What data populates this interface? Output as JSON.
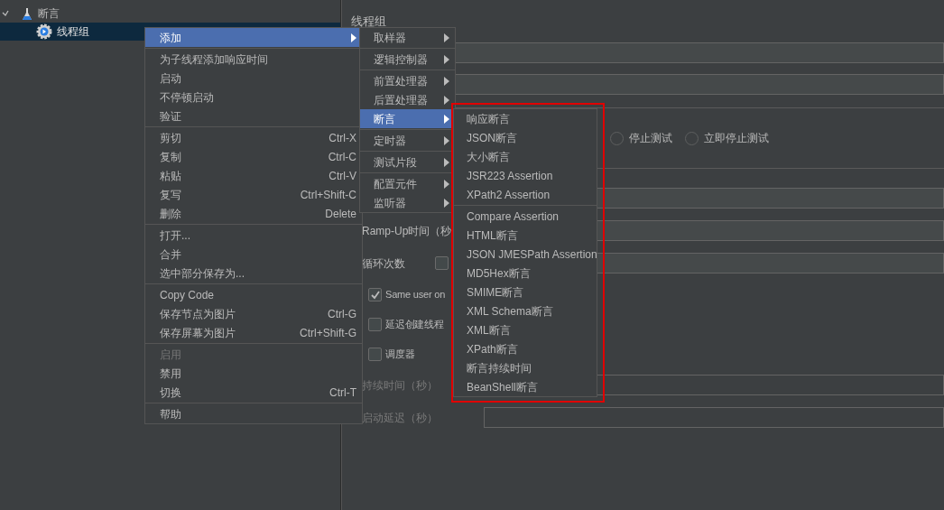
{
  "tree": [
    {
      "kind": "test_plan",
      "label": "断言",
      "expanded": true,
      "selected": false,
      "children": [
        {
          "kind": "thread_group",
          "label": "线程组",
          "selected": true
        }
      ]
    }
  ],
  "panel": {
    "title": "线程组",
    "error_actions": [
      {
        "label": "停止测试",
        "selected": false
      },
      {
        "label": "立即停止测试",
        "selected": false
      }
    ],
    "form": [
      {
        "kind": "field"
      },
      {
        "kind": "field",
        "label": "Ramp-Up时间（秒",
        "disabled": false
      },
      {
        "kind": "loop",
        "label": "循环次数",
        "checked": false
      },
      {
        "kind": "checkbox",
        "label": "Same user on",
        "checked": true
      },
      {
        "kind": "checkbox",
        "label": "延迟创建线程",
        "checked": false
      },
      {
        "kind": "checkbox",
        "label": "调度器",
        "checked": false
      },
      {
        "kind": "field",
        "label": "持续时间（秒）",
        "disabled": true
      },
      {
        "kind": "field",
        "label": "启动延迟（秒）",
        "disabled": true
      }
    ]
  },
  "context_menu": {
    "items": [
      {
        "kind": "item",
        "label": "添加",
        "submenu": true,
        "selected": true,
        "disabled": false
      },
      {
        "kind": "separator"
      },
      {
        "kind": "item",
        "label": "为子线程添加响应时间",
        "submenu": false,
        "selected": false,
        "disabled": false
      },
      {
        "kind": "item",
        "label": "启动",
        "submenu": false,
        "selected": false,
        "disabled": false
      },
      {
        "kind": "item",
        "label": "不停顿启动",
        "submenu": false,
        "selected": false,
        "disabled": false
      },
      {
        "kind": "item",
        "label": "验证",
        "submenu": false,
        "selected": false,
        "disabled": false
      },
      {
        "kind": "separator"
      },
      {
        "kind": "item",
        "label": "剪切",
        "shortcut": "Ctrl-X",
        "submenu": false,
        "selected": false,
        "disabled": false
      },
      {
        "kind": "item",
        "label": "复制",
        "shortcut": "Ctrl-C",
        "submenu": false,
        "selected": false,
        "disabled": false
      },
      {
        "kind": "item",
        "label": "粘贴",
        "shortcut": "Ctrl-V",
        "submenu": false,
        "selected": false,
        "disabled": false
      },
      {
        "kind": "item",
        "label": "复写",
        "shortcut": "Ctrl+Shift-C",
        "submenu": false,
        "selected": false,
        "disabled": false
      },
      {
        "kind": "item",
        "label": "删除",
        "shortcut": "Delete",
        "submenu": false,
        "selected": false,
        "disabled": false
      },
      {
        "kind": "separator"
      },
      {
        "kind": "item",
        "label": "打开...",
        "submenu": false,
        "selected": false,
        "disabled": false
      },
      {
        "kind": "item",
        "label": "合并",
        "submenu": false,
        "selected": false,
        "disabled": false
      },
      {
        "kind": "item",
        "label": "选中部分保存为...",
        "submenu": false,
        "selected": false,
        "disabled": false
      },
      {
        "kind": "separator"
      },
      {
        "kind": "item",
        "label": "Copy Code",
        "submenu": false,
        "selected": false,
        "disabled": false
      },
      {
        "kind": "item",
        "label": "保存节点为图片",
        "shortcut": "Ctrl-G",
        "submenu": false,
        "selected": false,
        "disabled": false
      },
      {
        "kind": "item",
        "label": "保存屏幕为图片",
        "shortcut": "Ctrl+Shift-G",
        "submenu": false,
        "selected": false,
        "disabled": false
      },
      {
        "kind": "separator"
      },
      {
        "kind": "item",
        "label": "启用",
        "submenu": false,
        "selected": false,
        "disabled": true
      },
      {
        "kind": "item",
        "label": "禁用",
        "submenu": false,
        "selected": false,
        "disabled": false
      },
      {
        "kind": "item",
        "label": "切换",
        "shortcut": "Ctrl-T",
        "submenu": false,
        "selected": false,
        "disabled": false
      },
      {
        "kind": "separator"
      },
      {
        "kind": "item",
        "label": "帮助",
        "submenu": false,
        "selected": false,
        "disabled": false
      }
    ]
  },
  "add_submenu": {
    "items": [
      {
        "kind": "item",
        "label": "取样器",
        "submenu": true,
        "selected": false
      },
      {
        "kind": "separator"
      },
      {
        "kind": "item",
        "label": "逻辑控制器",
        "submenu": true,
        "selected": false
      },
      {
        "kind": "separator"
      },
      {
        "kind": "item",
        "label": "前置处理器",
        "submenu": true,
        "selected": false
      },
      {
        "kind": "item",
        "label": "后置处理器",
        "submenu": true,
        "selected": false
      },
      {
        "kind": "item",
        "label": "断言",
        "submenu": true,
        "selected": true
      },
      {
        "kind": "separator"
      },
      {
        "kind": "item",
        "label": "定时器",
        "submenu": true,
        "selected": false
      },
      {
        "kind": "separator"
      },
      {
        "kind": "item",
        "label": "测试片段",
        "submenu": true,
        "selected": false
      },
      {
        "kind": "separator"
      },
      {
        "kind": "item",
        "label": "配置元件",
        "submenu": true,
        "selected": false
      },
      {
        "kind": "item",
        "label": "监听器",
        "submenu": true,
        "selected": false
      }
    ]
  },
  "assertion_submenu": {
    "highlighted": true,
    "items": [
      {
        "kind": "item",
        "label": "响应断言",
        "selected": false
      },
      {
        "kind": "item",
        "label": "JSON断言",
        "selected": false
      },
      {
        "kind": "item",
        "label": "大小断言",
        "selected": false
      },
      {
        "kind": "item",
        "label": "JSR223 Assertion",
        "selected": false
      },
      {
        "kind": "item",
        "label": "XPath2 Assertion",
        "selected": false
      },
      {
        "kind": "separator"
      },
      {
        "kind": "item",
        "label": "Compare Assertion",
        "selected": false
      },
      {
        "kind": "item",
        "label": "HTML断言",
        "selected": false
      },
      {
        "kind": "item",
        "label": "JSON JMESPath Assertion",
        "selected": false
      },
      {
        "kind": "item",
        "label": "MD5Hex断言",
        "selected": false
      },
      {
        "kind": "item",
        "label": "SMIME断言",
        "selected": false
      },
      {
        "kind": "item",
        "label": "XML Schema断言",
        "selected": false
      },
      {
        "kind": "item",
        "label": "XML断言",
        "selected": false
      },
      {
        "kind": "item",
        "label": "XPath断言",
        "selected": false
      },
      {
        "kind": "item",
        "label": "断言持续时间",
        "selected": false
      },
      {
        "kind": "item",
        "label": "BeanShell断言",
        "selected": false
      }
    ]
  }
}
